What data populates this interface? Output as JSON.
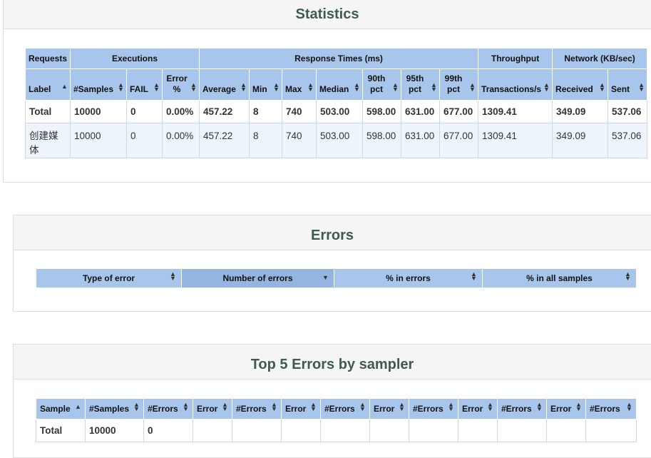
{
  "statistics": {
    "title": "Statistics",
    "group_headers": [
      "Requests",
      "Executions",
      "Response Times (ms)",
      "Throughput",
      "Network (KB/sec)"
    ],
    "columns": [
      "Label",
      "#Samples",
      "FAIL",
      "Error %",
      "Average",
      "Min",
      "Max",
      "Median",
      "90th pct",
      "95th pct",
      "99th pct",
      "Transactions/s",
      "Received",
      "Sent"
    ],
    "rows": [
      [
        "Total",
        "10000",
        "0",
        "0.00%",
        "457.22",
        "8",
        "740",
        "503.00",
        "598.00",
        "631.00",
        "677.00",
        "1309.41",
        "349.09",
        "537.06"
      ],
      [
        "创建媒体",
        "10000",
        "0",
        "0.00%",
        "457.22",
        "8",
        "740",
        "503.00",
        "598.00",
        "631.00",
        "677.00",
        "1309.41",
        "349.09",
        "537.06"
      ]
    ]
  },
  "errors": {
    "title": "Errors",
    "columns": [
      "Type of error",
      "Number of errors",
      "% in errors",
      "% in all samples"
    ]
  },
  "top5": {
    "title": "Top 5 Errors by sampler",
    "columns": [
      "Sample",
      "#Samples",
      "#Errors",
      "Error",
      "#Errors",
      "Error",
      "#Errors",
      "Error",
      "#Errors",
      "Error",
      "#Errors",
      "Error",
      "#Errors"
    ],
    "rows": [
      [
        "Total",
        "10000",
        "0",
        "",
        "",
        "",
        "",
        "",
        "",
        "",
        "",
        "",
        ""
      ]
    ]
  },
  "icons": {
    "sort_both": "sort-both-icon",
    "sort_asc": "sort-asc-icon",
    "sort_desc": "sort-desc-icon"
  },
  "colors": {
    "header_bg": "#a8c5ec",
    "title_color": "#3e5a52",
    "alt_row": "#eef4fc"
  }
}
